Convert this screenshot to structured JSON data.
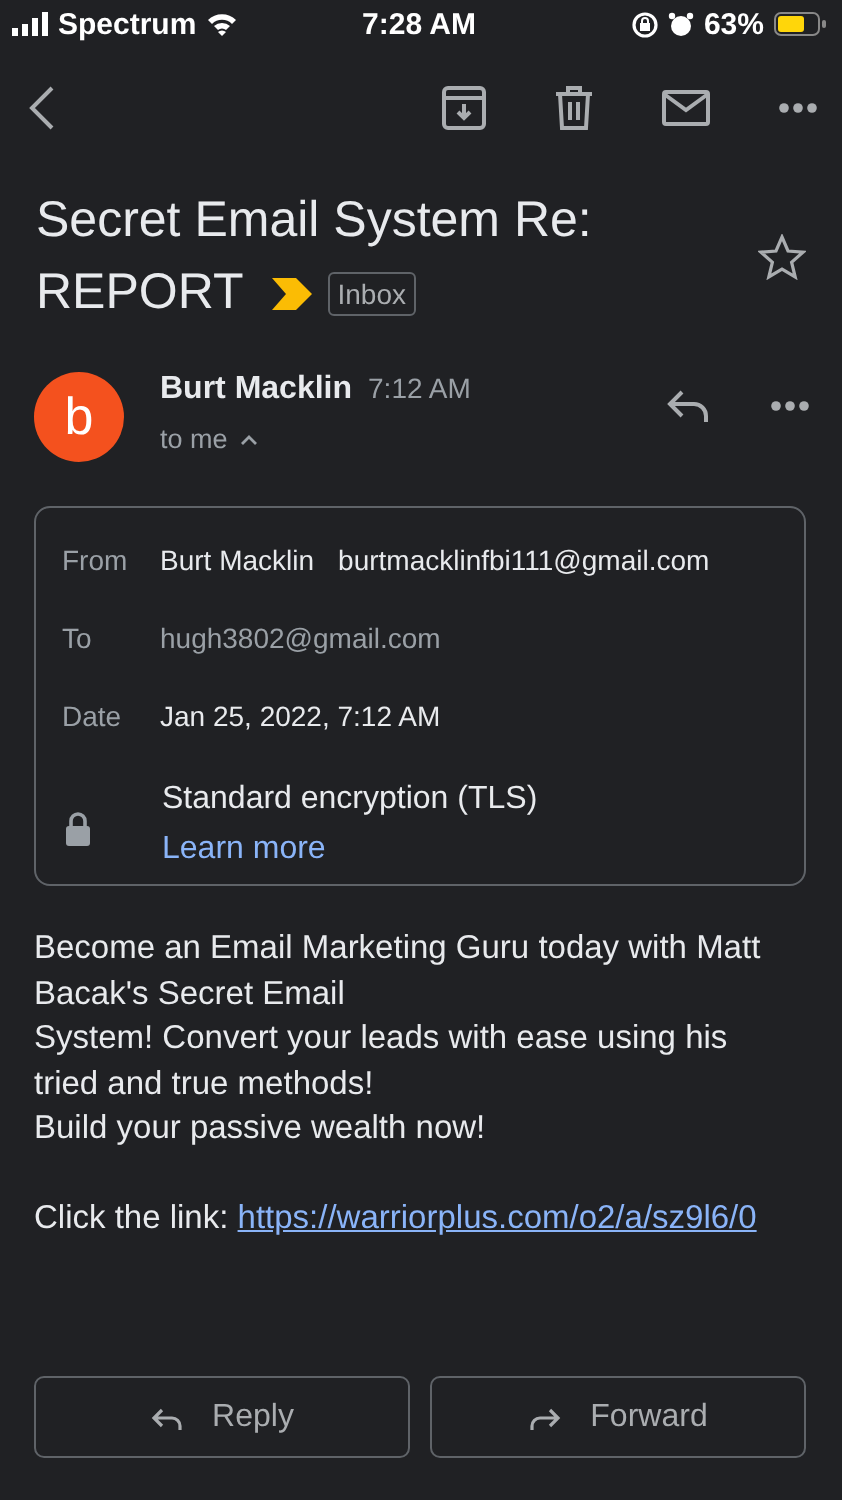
{
  "status_bar": {
    "carrier": "Spectrum",
    "time": "7:28 AM",
    "battery": "63%"
  },
  "subject": {
    "title_lines": [
      "Secret Email System Re:",
      "REPORT"
    ],
    "label": "Inbox",
    "important": true,
    "starred": false
  },
  "message": {
    "avatar_letter": "b",
    "sender": "Burt Macklin",
    "time": "7:12 AM",
    "recipient_summary": "to me",
    "details_expanded": true
  },
  "details": {
    "rows": [
      {
        "kind": "from",
        "label": "From",
        "name": "Burt Macklin",
        "value": "burtmacklinfbi111@gmail.com"
      },
      {
        "kind": "to",
        "label": "To",
        "value": "hugh3802@gmail.com"
      },
      {
        "kind": "date",
        "label": "Date",
        "value": "Jan 25, 2022, 7:12 AM"
      },
      {
        "kind": "security",
        "value": "Standard encryption (TLS)",
        "link": "Learn more"
      }
    ]
  },
  "body": {
    "paragraphs": [
      {
        "lines": [
          "Become an Email Marketing Guru today with Matt Bacak's Secret Email",
          "System! Convert your leads with ease using his tried and true methods!",
          "Build your passive wealth now!"
        ]
      },
      {
        "lines": [
          "Click the link: "
        ],
        "link": "https://warriorplus.com/o2/a/sz9l6/0"
      }
    ]
  },
  "actions": [
    {
      "kind": "reply",
      "label": "Reply"
    },
    {
      "kind": "forward",
      "label": "Forward"
    }
  ]
}
